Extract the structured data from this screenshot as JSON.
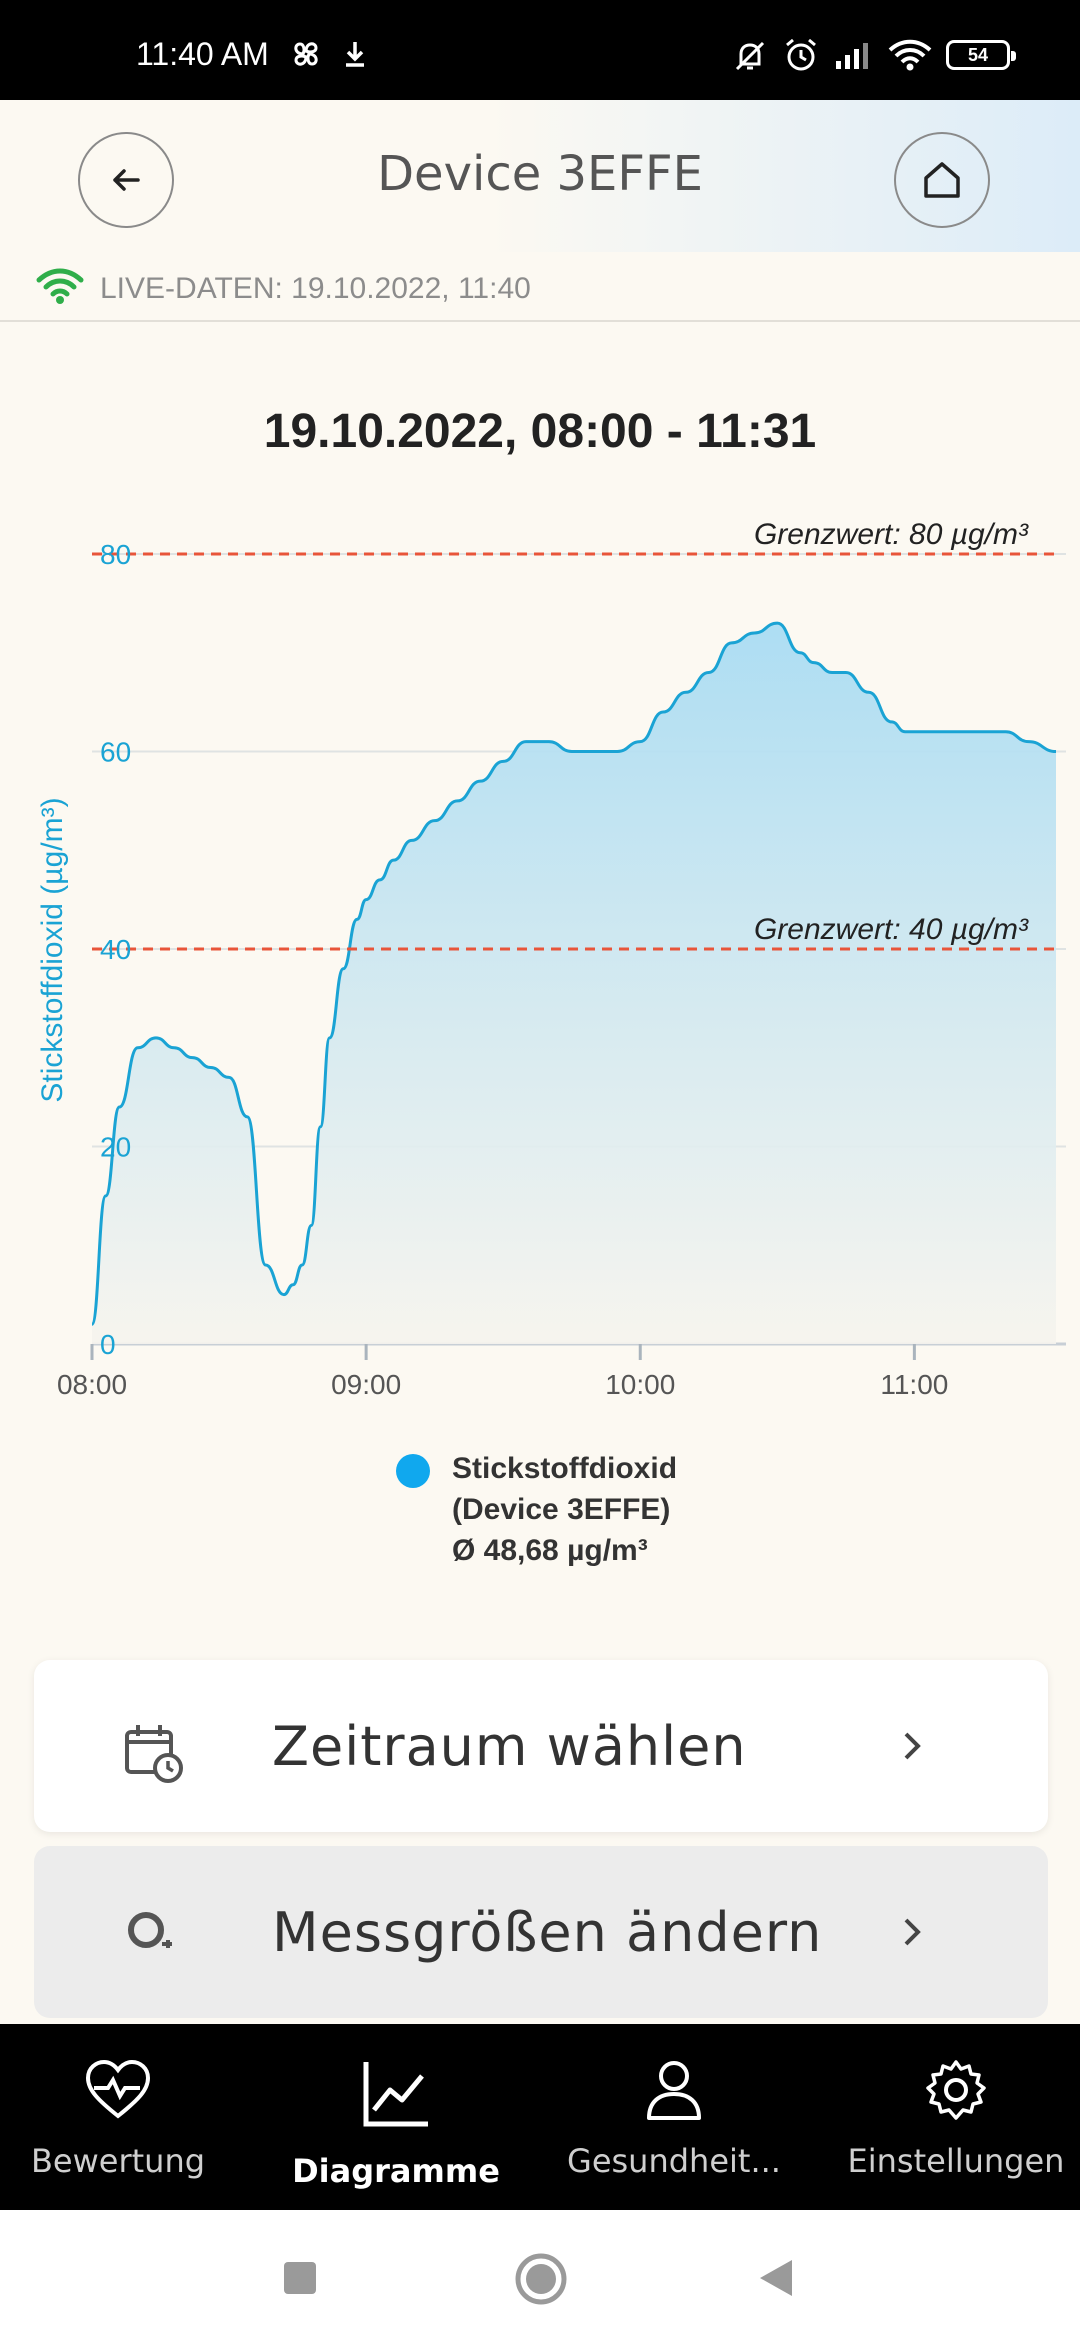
{
  "status_bar": {
    "time": "11:40 AM",
    "battery": "54"
  },
  "header": {
    "title": "Device 3EFFE"
  },
  "live": {
    "text": "LIVE-DATEN: 19.10.2022, 11:40"
  },
  "chart": {
    "title": "19.10.2022, 08:00 - 11:31"
  },
  "chart_data": {
    "type": "area",
    "title": "19.10.2022, 08:00 - 11:31",
    "xlabel": "",
    "ylabel": "Stickstoffdioxid (µg/m³)",
    "x_ticks": [
      "08:00",
      "09:00",
      "10:00",
      "11:00"
    ],
    "y_ticks": [
      "0",
      "20",
      "40",
      "60",
      "80"
    ],
    "ylim": [
      0,
      80
    ],
    "xlim_minutes_from_start": [
      0,
      211
    ],
    "grid": "horizontal",
    "thresholds": [
      {
        "label": "Grenzwert: 80 µg/m³",
        "value": 80,
        "color": "#e8553a"
      },
      {
        "label": "Grenzwert: 40 µg/m³",
        "value": 40,
        "color": "#e8553a"
      }
    ],
    "series": [
      {
        "name": "Stickstoffdioxid (Device 3EFFE)",
        "color": "#1aa3d4",
        "x": [
          "08:00",
          "08:03",
          "08:06",
          "08:10",
          "08:14",
          "08:18",
          "08:22",
          "08:26",
          "08:30",
          "08:34",
          "08:38",
          "08:42",
          "08:44",
          "08:46",
          "08:48",
          "08:50",
          "08:52",
          "08:55",
          "08:58",
          "09:00",
          "09:03",
          "09:06",
          "09:10",
          "09:15",
          "09:20",
          "09:25",
          "09:30",
          "09:35",
          "09:40",
          "09:45",
          "09:50",
          "09:53",
          "09:55",
          "10:00",
          "10:05",
          "10:10",
          "10:15",
          "10:20",
          "10:25",
          "10:30",
          "10:35",
          "10:38",
          "10:42",
          "10:45",
          "10:50",
          "10:55",
          "10:58",
          "11:00",
          "11:05",
          "11:10",
          "11:15",
          "11:20",
          "11:25",
          "11:31"
        ],
        "values": [
          2,
          15,
          24,
          30,
          31,
          30,
          29,
          28,
          27,
          23,
          8,
          5,
          6,
          8,
          12,
          22,
          31,
          38,
          43,
          45,
          47,
          49,
          51,
          53,
          55,
          57,
          59,
          61,
          61,
          60,
          60,
          60,
          60,
          61,
          64,
          66,
          68,
          71,
          72,
          73,
          70,
          69,
          68,
          68,
          66,
          63,
          62,
          62,
          62,
          62,
          62,
          62,
          61,
          60
        ]
      }
    ],
    "legend": {
      "position": "bottom",
      "lines": [
        "Stickstoffdioxid",
        "(Device 3EFFE)",
        "Ø 48,68 µg/m³"
      ]
    }
  },
  "cards": {
    "period_label": "Zeitraum wählen",
    "measures_label": "Messgrößen ändern"
  },
  "bottom_nav": {
    "items": [
      {
        "label": "Bewertung",
        "icon": "heart-pulse-icon"
      },
      {
        "label": "Diagramme",
        "icon": "chart-icon"
      },
      {
        "label": "Gesundheit...",
        "icon": "person-icon"
      },
      {
        "label": "Einstellungen",
        "icon": "gear-icon"
      }
    ],
    "active_index": 1
  }
}
